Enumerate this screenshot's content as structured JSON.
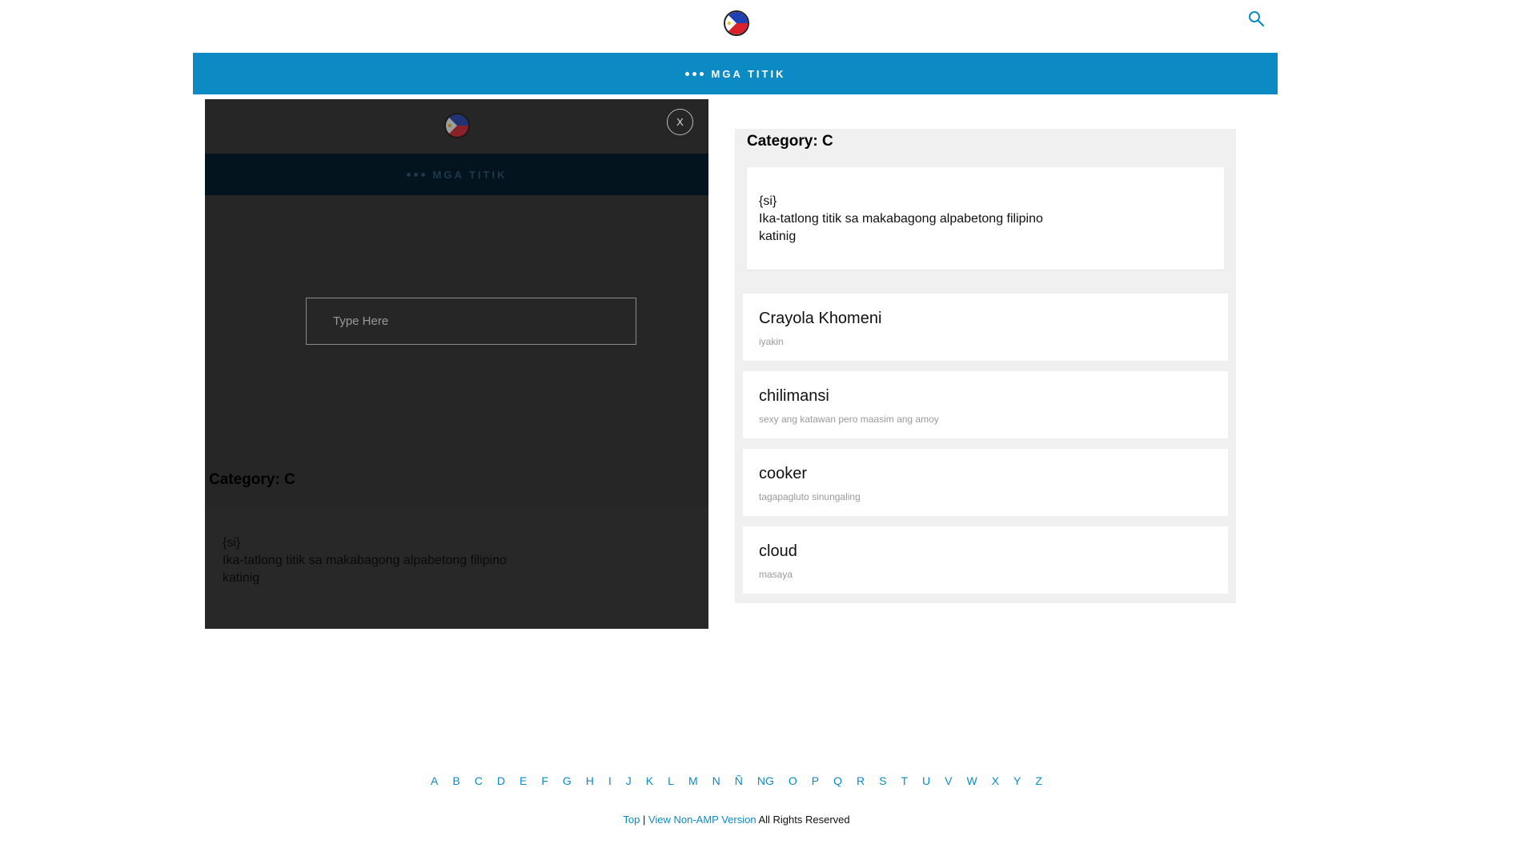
{
  "header": {
    "logo_alt": "Philippine flag logo",
    "search_icon": "search-icon"
  },
  "nav": {
    "label": "MGA TITIK",
    "icon": "dots-menu-icon"
  },
  "modal": {
    "close_label": "X",
    "nav_label": "MGA TITIK",
    "input_placeholder": "Type Here",
    "input_value": "",
    "category_title": "Category: C",
    "letter": {
      "line1": "{si}",
      "line2": "Ika-tatlong titik sa makabagong alpabetong filipino",
      "line3": "katinig"
    }
  },
  "main": {
    "category_title": "Category: C",
    "letter": {
      "line1": "{si}",
      "line2": "Ika-tatlong titik sa makabagong alpabetong filipino",
      "line3": "katinig"
    },
    "words": [
      {
        "title": "Crayola Khomeni",
        "definition": "iyakin"
      },
      {
        "title": "chilimansi",
        "definition": "sexy ang katawan pero maasim ang amoy"
      },
      {
        "title": "cooker",
        "definition": "tagapagluto sinungaling"
      },
      {
        "title": "cloud",
        "definition": "masaya"
      }
    ]
  },
  "alphabet": [
    "A",
    "B",
    "C",
    "D",
    "E",
    "F",
    "G",
    "H",
    "I",
    "J",
    "K",
    "L",
    "M",
    "N",
    "Ñ",
    "NG",
    "O",
    "P",
    "Q",
    "R",
    "S",
    "T",
    "U",
    "V",
    "W",
    "X",
    "Y",
    "Z"
  ],
  "footer": {
    "top_link": "Top",
    "separator": " | ",
    "non_amp_link": "View Non-AMP Version",
    "rights": " All Rights Reserved"
  },
  "colors": {
    "accent": "#0b8ac4",
    "modal_bg": "#262626",
    "panel_bg": "#f0f0f0"
  }
}
